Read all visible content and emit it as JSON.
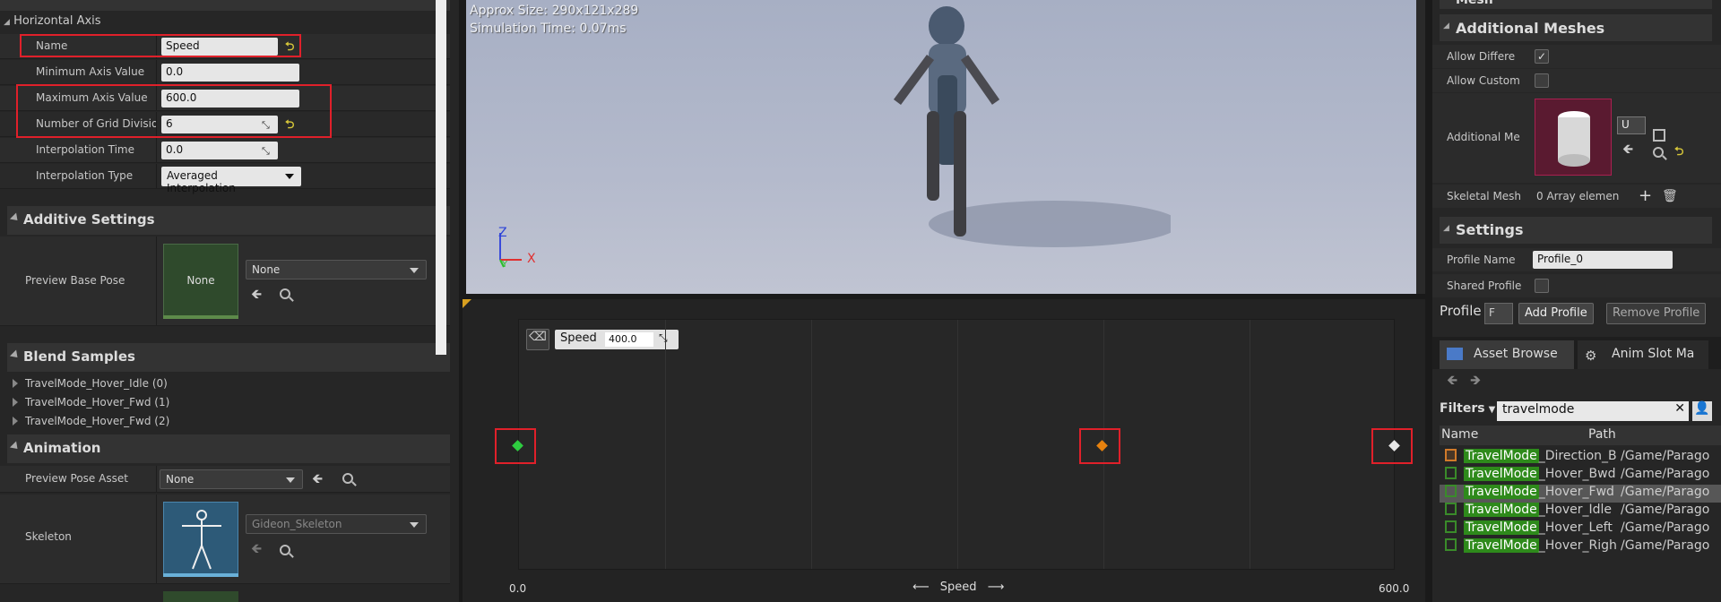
{
  "left": {
    "horizontal_axis": {
      "header": "Horizontal Axis",
      "name_label": "Name",
      "name_value": "Speed",
      "min_label": "Minimum Axis Value",
      "min_value": "0.0",
      "max_label": "Maximum Axis Value",
      "max_value": "600.0",
      "grid_label": "Number of Grid Division",
      "grid_value": "6",
      "interp_time_label": "Interpolation Time",
      "interp_time_value": "0.0",
      "interp_type_label": "Interpolation Type",
      "interp_type_value": "Averaged Interpolation"
    },
    "additive": {
      "header": "Additive Settings",
      "preview_base_pose_label": "Preview Base Pose",
      "thumb_text": "None",
      "dropdown_value": "None"
    },
    "blend_samples": {
      "header": "Blend Samples",
      "items": [
        "TravelMode_Hover_Idle (0)",
        "TravelMode_Hover_Fwd (1)",
        "TravelMode_Hover_Fwd (2)"
      ]
    },
    "animation": {
      "header": "Animation",
      "preview_pose_label": "Preview Pose Asset",
      "preview_pose_value": "None",
      "skeleton_label": "Skeleton",
      "skeleton_value": "Gideon_Skeleton"
    }
  },
  "viewport": {
    "approx_size": "Approx Size: 290x121x289",
    "sim_time": "Simulation Time: 0.07ms",
    "axis_z": "Z",
    "axis_x": "X",
    "axis_y": "Y"
  },
  "graph": {
    "param_label": "Speed",
    "param_value": "400.0",
    "x_min_label": "0.0",
    "x_max_label": "600.0",
    "x_axis_label": "Speed",
    "arrow_left": "⟵",
    "arrow_right": "⟶",
    "samples": [
      {
        "speed": 0,
        "color": "#2ecc40"
      },
      {
        "speed": 400,
        "color": "#e8820e"
      },
      {
        "speed": 600,
        "color": "#e8e8e8"
      }
    ],
    "grid_divisions": 6
  },
  "right": {
    "mesh_header": "Mesh",
    "additional_meshes_header": "Additional Meshes",
    "allow_different_label": "Allow Differen",
    "allow_custom_label": "Allow Custom",
    "additional_mesh_label": "Additional Me",
    "mesh_dropdown": "U",
    "skeletal_mesh_label": "Skeletal Mesh",
    "skeletal_mesh_value": "0 Array elemen",
    "settings_header": "Settings",
    "profile_name_label": "Profile Name",
    "profile_name_value": "Profile_0",
    "shared_profile_label": "Shared Profile",
    "profile_label": "Profile",
    "profile_dropdown": "F",
    "add_profile": "Add Profile",
    "remove_profile": "Remove Profile",
    "tab_asset_browser": "Asset Browse",
    "tab_anim_slot": "Anim Slot Ma",
    "filters_label": "Filters",
    "search_value": "travelmode",
    "col_name": "Name",
    "col_path": "Path",
    "assets": [
      {
        "hl": "TravelMode",
        "rest": "_Direction_B",
        "path": "/Game/Parago",
        "kind": "blendspace"
      },
      {
        "hl": "TravelMode",
        "rest": "_Hover_Bwd",
        "path": "/Game/Parago",
        "kind": "anim"
      },
      {
        "hl": "TravelMode",
        "rest": "_Hover_Fwd",
        "path": "/Game/Parago",
        "kind": "anim"
      },
      {
        "hl": "TravelMode",
        "rest": "_Hover_Idle",
        "path": "/Game/Parago",
        "kind": "anim"
      },
      {
        "hl": "TravelMode",
        "rest": "_Hover_Left",
        "path": "/Game/Parago",
        "kind": "anim"
      },
      {
        "hl": "TravelMode",
        "rest": "_Hover_Righ",
        "path": "/Game/Parago",
        "kind": "anim"
      }
    ]
  }
}
